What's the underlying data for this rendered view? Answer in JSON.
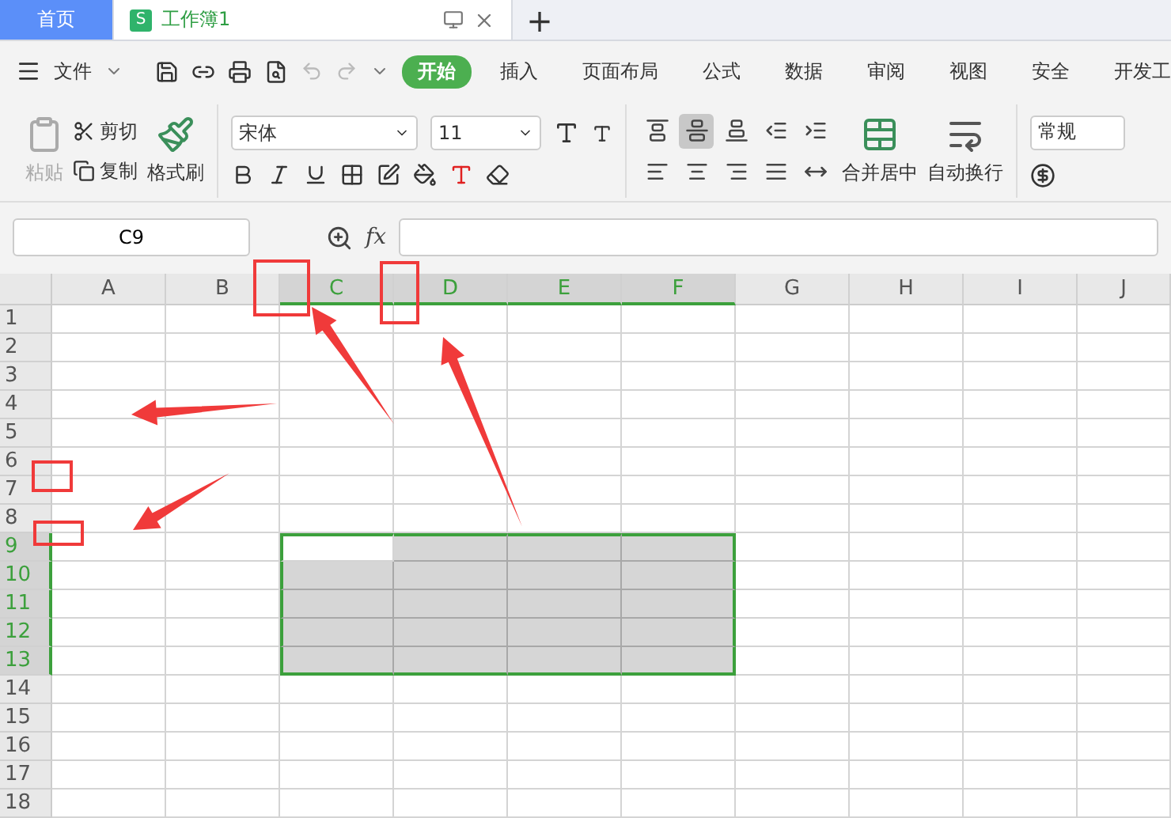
{
  "home_button": "首页",
  "tabs": [
    {
      "label": "工作簿1",
      "icon": "S",
      "selected": true
    }
  ],
  "new_tab": "+",
  "menu": {
    "file": "文件",
    "items": [
      {
        "label": "开始",
        "selected": true
      },
      {
        "label": "插入",
        "selected": false
      },
      {
        "label": "页面布局",
        "selected": false
      },
      {
        "label": "公式",
        "selected": false
      },
      {
        "label": "数据",
        "selected": false
      },
      {
        "label": "审阅",
        "selected": false
      },
      {
        "label": "视图",
        "selected": false
      },
      {
        "label": "安全",
        "selected": false
      },
      {
        "label": "开发工",
        "selected": false
      }
    ]
  },
  "ribbon": {
    "paste": {
      "label": "粘贴",
      "disabled": true
    },
    "cut": "剪切",
    "copy": "复制",
    "format_painter": "格式刷",
    "font": "宋体",
    "size": "11",
    "alignment": [
      {
        "kind": "top",
        "selected": false
      },
      {
        "kind": "middle",
        "selected": true
      },
      {
        "kind": "bottom",
        "selected": false
      },
      {
        "kind": "outdent",
        "selected": false
      },
      {
        "kind": "indent",
        "selected": false
      },
      {
        "kind": "left",
        "selected": false
      },
      {
        "kind": "center",
        "selected": false
      },
      {
        "kind": "right",
        "selected": false
      },
      {
        "kind": "justify",
        "selected": false
      },
      {
        "kind": "distribute",
        "selected": false
      }
    ],
    "merge": "合并居中",
    "wrap": "自动换行",
    "number_format": "常规"
  },
  "name_box": "C9",
  "fx": "fx",
  "columns": [
    {
      "label": "A",
      "selected": false,
      "active": false
    },
    {
      "label": "B",
      "selected": false,
      "active": false
    },
    {
      "label": "C",
      "selected": true,
      "active": true
    },
    {
      "label": "D",
      "selected": true,
      "active": false
    },
    {
      "label": "E",
      "selected": true,
      "active": false
    },
    {
      "label": "F",
      "selected": true,
      "active": false
    },
    {
      "label": "G",
      "selected": false,
      "active": false
    },
    {
      "label": "H",
      "selected": false,
      "active": false
    },
    {
      "label": "I",
      "selected": false,
      "active": false
    },
    {
      "label": "J",
      "selected": false,
      "active": false
    }
  ],
  "rows": [
    {
      "label": "1",
      "selected": false,
      "active": false
    },
    {
      "label": "2",
      "selected": false,
      "active": false
    },
    {
      "label": "3",
      "selected": false,
      "active": false
    },
    {
      "label": "4",
      "selected": false,
      "active": false
    },
    {
      "label": "5",
      "selected": false,
      "active": false
    },
    {
      "label": "6",
      "selected": false,
      "active": false
    },
    {
      "label": "7",
      "selected": false,
      "active": false
    },
    {
      "label": "8",
      "selected": false,
      "active": false
    },
    {
      "label": "9",
      "selected": true,
      "active": true
    },
    {
      "label": "10",
      "selected": true,
      "active": false
    },
    {
      "label": "11",
      "selected": true,
      "active": false
    },
    {
      "label": "12",
      "selected": true,
      "active": false
    },
    {
      "label": "13",
      "selected": true,
      "active": false
    },
    {
      "label": "14",
      "selected": false,
      "active": false
    },
    {
      "label": "15",
      "selected": false,
      "active": false
    },
    {
      "label": "16",
      "selected": false,
      "active": false
    },
    {
      "label": "17",
      "selected": false,
      "active": false
    },
    {
      "label": "18",
      "selected": false,
      "active": false
    }
  ]
}
